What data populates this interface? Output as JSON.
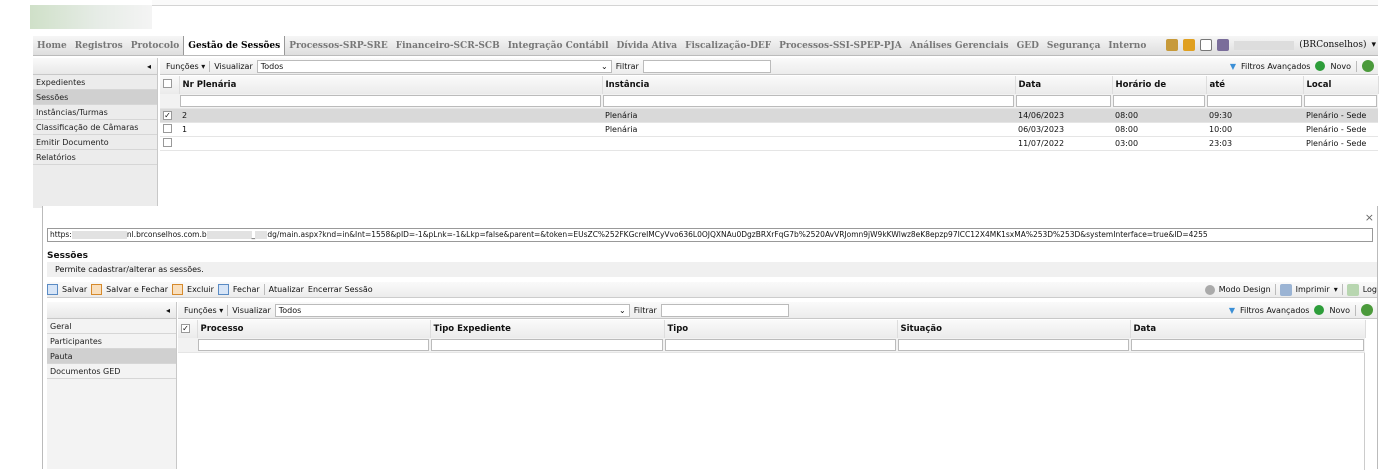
{
  "menu": {
    "items": [
      "Home",
      "Registros",
      "Protocolo",
      "Gestão de Sessões",
      "Processos-SRP-SRE",
      "Financeiro-SCR-SCB",
      "Integração Contábil",
      "Dívida Ativa",
      "Fiscalização-DEF",
      "Processos-SSI-SPEP-PJA",
      "Análises Gerenciais",
      "GED",
      "Segurança",
      "Interno"
    ],
    "user": "(BRConselhos)",
    "dropdown": "▾"
  },
  "leftnav": {
    "collapse": "◂",
    "items": [
      "Expedientes",
      "Sessões",
      "Instâncias/Turmas",
      "Classificação de Câmaras",
      "Emitir Documento",
      "Relatórios"
    ]
  },
  "toolbar1": {
    "funcoes": "Funções ▾",
    "visualizar": "Visualizar",
    "view_value": "Todos",
    "filtrar": "Filtrar",
    "filtros": "Filtros Avançados",
    "novo": "Novo",
    "chevron": "⌄"
  },
  "grid1": {
    "headers": [
      "Nr Plenária",
      "Instância",
      "Data",
      "Horário de",
      "até",
      "Local"
    ],
    "rows": [
      {
        "check": "✓",
        "nr": "2",
        "instancia": "Plenária",
        "data": "14/06/2023",
        "inicio": "08:00",
        "fim": "09:30",
        "local": "Plenário - Sede"
      },
      {
        "check": "",
        "nr": "1",
        "instancia": "Plenária",
        "data": "06/03/2023",
        "inicio": "08:00",
        "fim": "10:00",
        "local": "Plenário - Sede"
      },
      {
        "check": "",
        "nr": "",
        "instancia": "",
        "data": "11/07/2022",
        "inicio": "03:00",
        "fim": "23:03",
        "local": "Plenário - Sede"
      }
    ]
  },
  "dialog": {
    "close": "×",
    "url_a": "https:",
    "url_b": "nl.brconselhos.com.b",
    "url_c": "_",
    "url_d": "dg/main.aspx?knd=in&Int=1558&pID=-1&pLnk=-1&Lkp=false&parent=&token=EUsZC%252FKGcreIMCyVvo636L0OJQXNAu0DgzBRXrFqG7b%2520AvVRJomn9jW9kKWlwz8eK8epzp97ICC12X4MK1sxMA%253D%253D&systemInterface=true&ID=4255",
    "title": "Sessões",
    "desc": "Permite cadastrar/alterar as sessões.",
    "tools": {
      "salvar": "Salvar",
      "salvar_fechar": "Salvar e Fechar",
      "excluir": "Excluir",
      "fechar": "Fechar",
      "atualizar": "Atualizar",
      "encerrar": "Encerrar Sessão",
      "modo": "Modo Design",
      "imprimir": "Imprimir",
      "log": "Log"
    },
    "nav": [
      "Geral",
      "Participantes",
      "Pauta",
      "Documentos GED"
    ],
    "headers": [
      "Processo",
      "Tipo Expediente",
      "Tipo",
      "Situação",
      "Data"
    ]
  }
}
